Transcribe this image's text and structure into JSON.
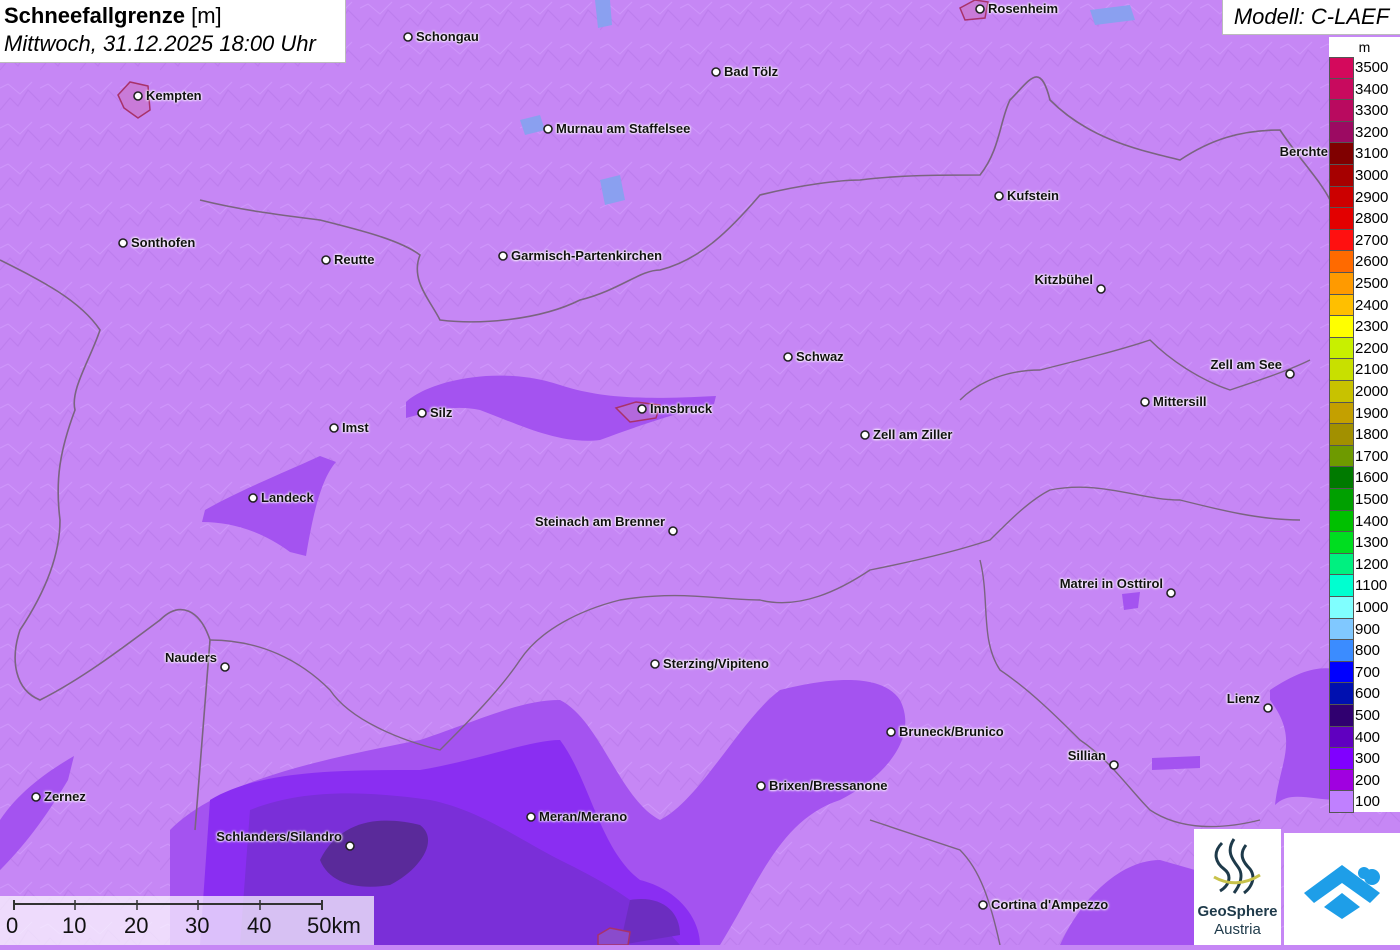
{
  "title": {
    "variable": "Schneefallgrenze",
    "unit": "[m]",
    "datetime": "Mittwoch, 31.12.2025 18:00 Uhr"
  },
  "model": "Modell: C-LAEF",
  "legend": {
    "unit": "m",
    "levels": [
      {
        "label": "3500",
        "color": "#d4095c"
      },
      {
        "label": "3400",
        "color": "#c80a5e"
      },
      {
        "label": "3300",
        "color": "#b90a5f"
      },
      {
        "label": "3200",
        "color": "#9c0a62"
      },
      {
        "label": "3100",
        "color": "#800000"
      },
      {
        "label": "3000",
        "color": "#a60000"
      },
      {
        "label": "2900",
        "color": "#cc0000"
      },
      {
        "label": "2800",
        "color": "#e30000"
      },
      {
        "label": "2700",
        "color": "#ff1010"
      },
      {
        "label": "2600",
        "color": "#ff6a00"
      },
      {
        "label": "2500",
        "color": "#ff9a00"
      },
      {
        "label": "2400",
        "color": "#ffbf00"
      },
      {
        "label": "2300",
        "color": "#ffff00"
      },
      {
        "label": "2200",
        "color": "#c8f000"
      },
      {
        "label": "2100",
        "color": "#c8e000"
      },
      {
        "label": "2000",
        "color": "#c8c200"
      },
      {
        "label": "1900",
        "color": "#c4a000"
      },
      {
        "label": "1800",
        "color": "#a29000"
      },
      {
        "label": "1700",
        "color": "#6e9a00"
      },
      {
        "label": "1600",
        "color": "#007a00"
      },
      {
        "label": "1500",
        "color": "#00a000"
      },
      {
        "label": "1400",
        "color": "#00c000"
      },
      {
        "label": "1300",
        "color": "#00dd20"
      },
      {
        "label": "1200",
        "color": "#00f080"
      },
      {
        "label": "1100",
        "color": "#00ffd0"
      },
      {
        "label": "1000",
        "color": "#80ffff"
      },
      {
        "label": "900",
        "color": "#80c8ff"
      },
      {
        "label": "800",
        "color": "#3b8cff"
      },
      {
        "label": "700",
        "color": "#0000ff"
      },
      {
        "label": "600",
        "color": "#0010b0"
      },
      {
        "label": "500",
        "color": "#300070"
      },
      {
        "label": "400",
        "color": "#6000c0"
      },
      {
        "label": "300",
        "color": "#8000ff"
      },
      {
        "label": "200",
        "color": "#a000e0"
      },
      {
        "label": "100",
        "color": "#c080ff"
      }
    ]
  },
  "cities": [
    {
      "name": "Rosenheim"
    },
    {
      "name": "Schongau"
    },
    {
      "name": "Bad Tölz"
    },
    {
      "name": "Kempten"
    },
    {
      "name": "Murnau am Staffelsee"
    },
    {
      "name": "Berchte"
    },
    {
      "name": "Kufstein"
    },
    {
      "name": "Sonthofen"
    },
    {
      "name": "Reutte"
    },
    {
      "name": "Garmisch-Partenkirchen"
    },
    {
      "name": "Kitzbühel"
    },
    {
      "name": "Schwaz"
    },
    {
      "name": "Zell am See"
    },
    {
      "name": "Mittersill"
    },
    {
      "name": "Innsbruck"
    },
    {
      "name": "Silz"
    },
    {
      "name": "Imst"
    },
    {
      "name": "Zell am Ziller"
    },
    {
      "name": "Landeck"
    },
    {
      "name": "Steinach am Brenner"
    },
    {
      "name": "Matrei in Osttirol"
    },
    {
      "name": "Nauders"
    },
    {
      "name": "Sterzing/Vipiteno"
    },
    {
      "name": "Lienz"
    },
    {
      "name": "Bruneck/Brunico"
    },
    {
      "name": "Sillian"
    },
    {
      "name": "Brixen/Bressanone"
    },
    {
      "name": "Zernez"
    },
    {
      "name": "Meran/Merano"
    },
    {
      "name": "Schlanders/Silandro"
    },
    {
      "name": "Cortina d'Ampezzo"
    }
  ],
  "scale": {
    "ticks": [
      "0",
      "10",
      "20",
      "30",
      "40",
      "50km"
    ]
  },
  "logo": {
    "name": "GeoSphere",
    "sub": "Austria"
  }
}
